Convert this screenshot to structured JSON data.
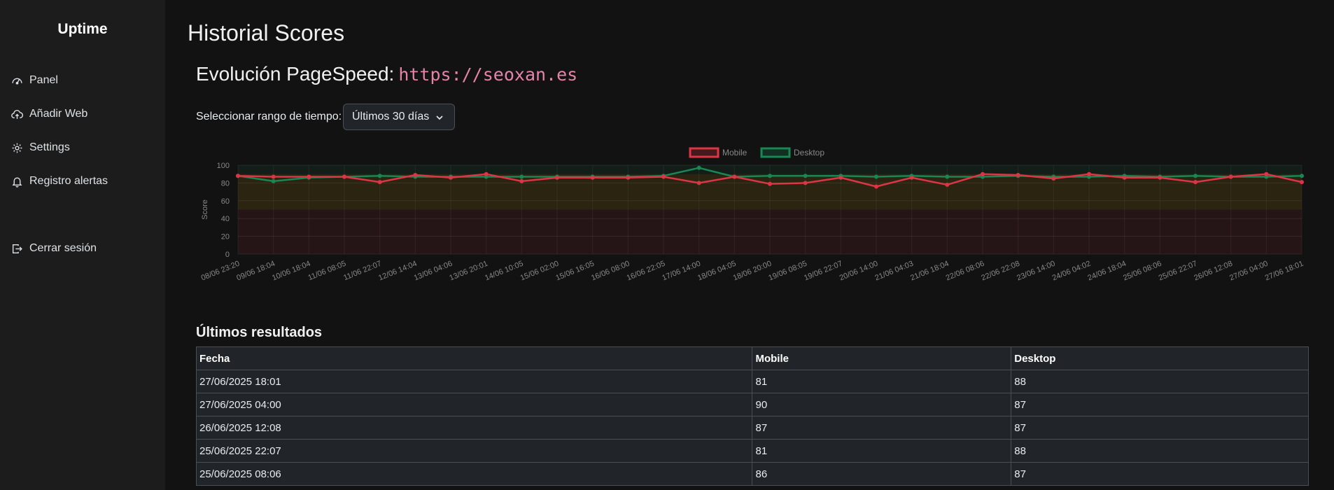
{
  "sidebar": {
    "brand": "Uptime",
    "items": [
      {
        "label": "Panel",
        "icon": "gauge-icon"
      },
      {
        "label": "Añadir Web",
        "icon": "cloud-upload-icon"
      },
      {
        "label": "Settings",
        "icon": "gear-icon"
      },
      {
        "label": "Registro alertas",
        "icon": "bell-icon"
      }
    ],
    "logout": {
      "label": "Cerrar sesión",
      "icon": "logout-icon"
    }
  },
  "main": {
    "title": "Historial Scores",
    "subtitle_prefix": "Evolución PageSpeed:",
    "url": "https://seoxan.es",
    "range_label": "Seleccionar rango de tiempo:",
    "range_value": "Últimos 30 días",
    "table_title": "Últimos resultados",
    "table": {
      "headers": [
        "Fecha",
        "Mobile",
        "Desktop"
      ],
      "rows": [
        [
          "27/06/2025 18:01",
          "81",
          "88"
        ],
        [
          "27/06/2025 04:00",
          "90",
          "87"
        ],
        [
          "26/06/2025 12:08",
          "87",
          "87"
        ],
        [
          "25/06/2025 22:07",
          "81",
          "88"
        ],
        [
          "25/06/2025 08:06",
          "86",
          "87"
        ]
      ]
    }
  },
  "colors": {
    "mobile": "#dc3545",
    "desktop": "#198754",
    "accent_url": "#e683a8"
  },
  "chart_data": {
    "type": "line",
    "title": "",
    "xlabel": "",
    "ylabel": "Score",
    "ylim": [
      0,
      100
    ],
    "yticks": [
      0,
      20,
      40,
      60,
      80,
      100
    ],
    "legend_position": "top",
    "grid": true,
    "zones": [
      {
        "from": 90,
        "to": 100,
        "color": "#198754"
      },
      {
        "from": 50,
        "to": 90,
        "color": "#ffc107"
      },
      {
        "from": 0,
        "to": 50,
        "color": "#dc3545"
      }
    ],
    "x": [
      "08/06 23:20",
      "09/06 18:04",
      "10/06 18:04",
      "11/06 08:05",
      "11/06 22:07",
      "12/06 14:04",
      "13/06 04:06",
      "13/06 20:01",
      "14/06 10:05",
      "15/06 02:00",
      "15/06 16:05",
      "16/06 08:00",
      "16/06 22:05",
      "17/06 14:00",
      "18/06 04:05",
      "18/06 20:00",
      "19/06 08:05",
      "19/06 22:07",
      "20/06 14:00",
      "21/06 04:03",
      "21/06 18:04",
      "22/06 08:06",
      "22/06 22:08",
      "23/06 14:00",
      "24/06 04:02",
      "24/06 18:04",
      "25/06 08:06",
      "25/06 22:07",
      "26/06 12:08",
      "27/06 04:00",
      "27/06 18:01"
    ],
    "series": [
      {
        "name": "Mobile",
        "color": "#dc3545",
        "values": [
          88,
          87,
          87,
          87,
          81,
          89,
          86,
          90,
          82,
          86,
          86,
          86,
          87,
          80,
          87,
          79,
          80,
          86,
          76,
          86,
          78,
          90,
          89,
          85,
          90,
          86,
          86,
          81,
          87,
          90,
          81
        ]
      },
      {
        "name": "Desktop",
        "color": "#198754",
        "values": [
          88,
          82,
          86,
          87,
          88,
          87,
          87,
          87,
          87,
          87,
          87,
          87,
          88,
          97,
          87,
          88,
          88,
          88,
          87,
          88,
          87,
          87,
          88,
          87,
          87,
          88,
          87,
          88,
          87,
          87,
          88
        ]
      }
    ]
  }
}
